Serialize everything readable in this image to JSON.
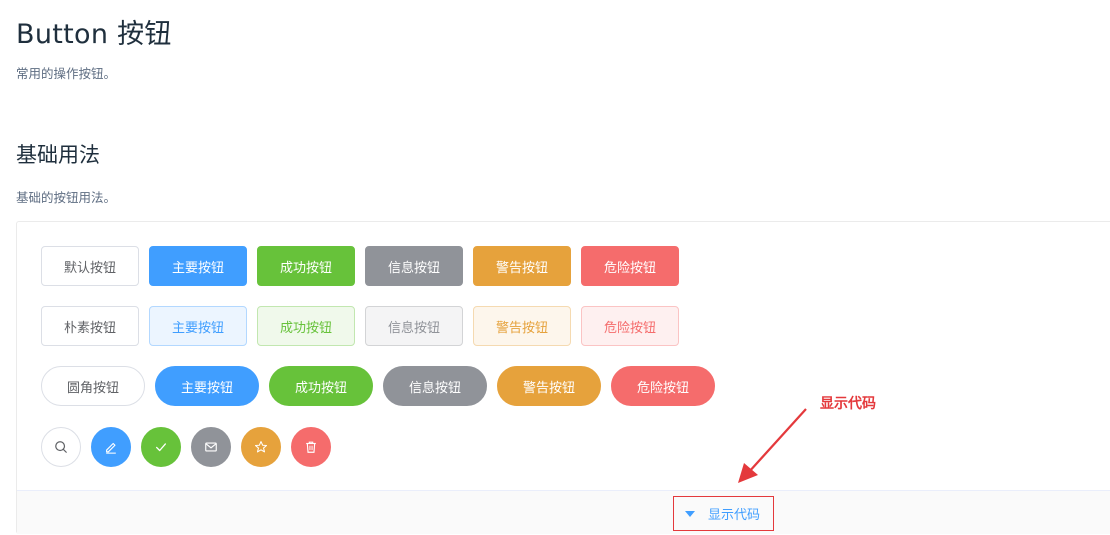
{
  "page": {
    "title": "Button 按钮",
    "description": "常用的操作按钮。"
  },
  "section": {
    "title": "基础用法",
    "description": "基础的按钮用法。"
  },
  "rows": {
    "default": [
      "默认按钮",
      "主要按钮",
      "成功按钮",
      "信息按钮",
      "警告按钮",
      "危险按钮"
    ],
    "plain": [
      "朴素按钮",
      "主要按钮",
      "成功按钮",
      "信息按钮",
      "警告按钮",
      "危险按钮"
    ],
    "round": [
      "圆角按钮",
      "主要按钮",
      "成功按钮",
      "信息按钮",
      "警告按钮",
      "危险按钮"
    ],
    "circle_icons": [
      "search-icon",
      "edit-icon",
      "check-icon",
      "message-icon",
      "star-icon",
      "delete-icon"
    ]
  },
  "control": {
    "toggle_label": "显示代码"
  },
  "annotation": {
    "label": "显示代码"
  },
  "colors": {
    "primary": "#409eff",
    "success": "#67c23a",
    "info": "#909399",
    "warning": "#e6a23c",
    "danger": "#f56c6c",
    "annotation": "#e4393c"
  }
}
